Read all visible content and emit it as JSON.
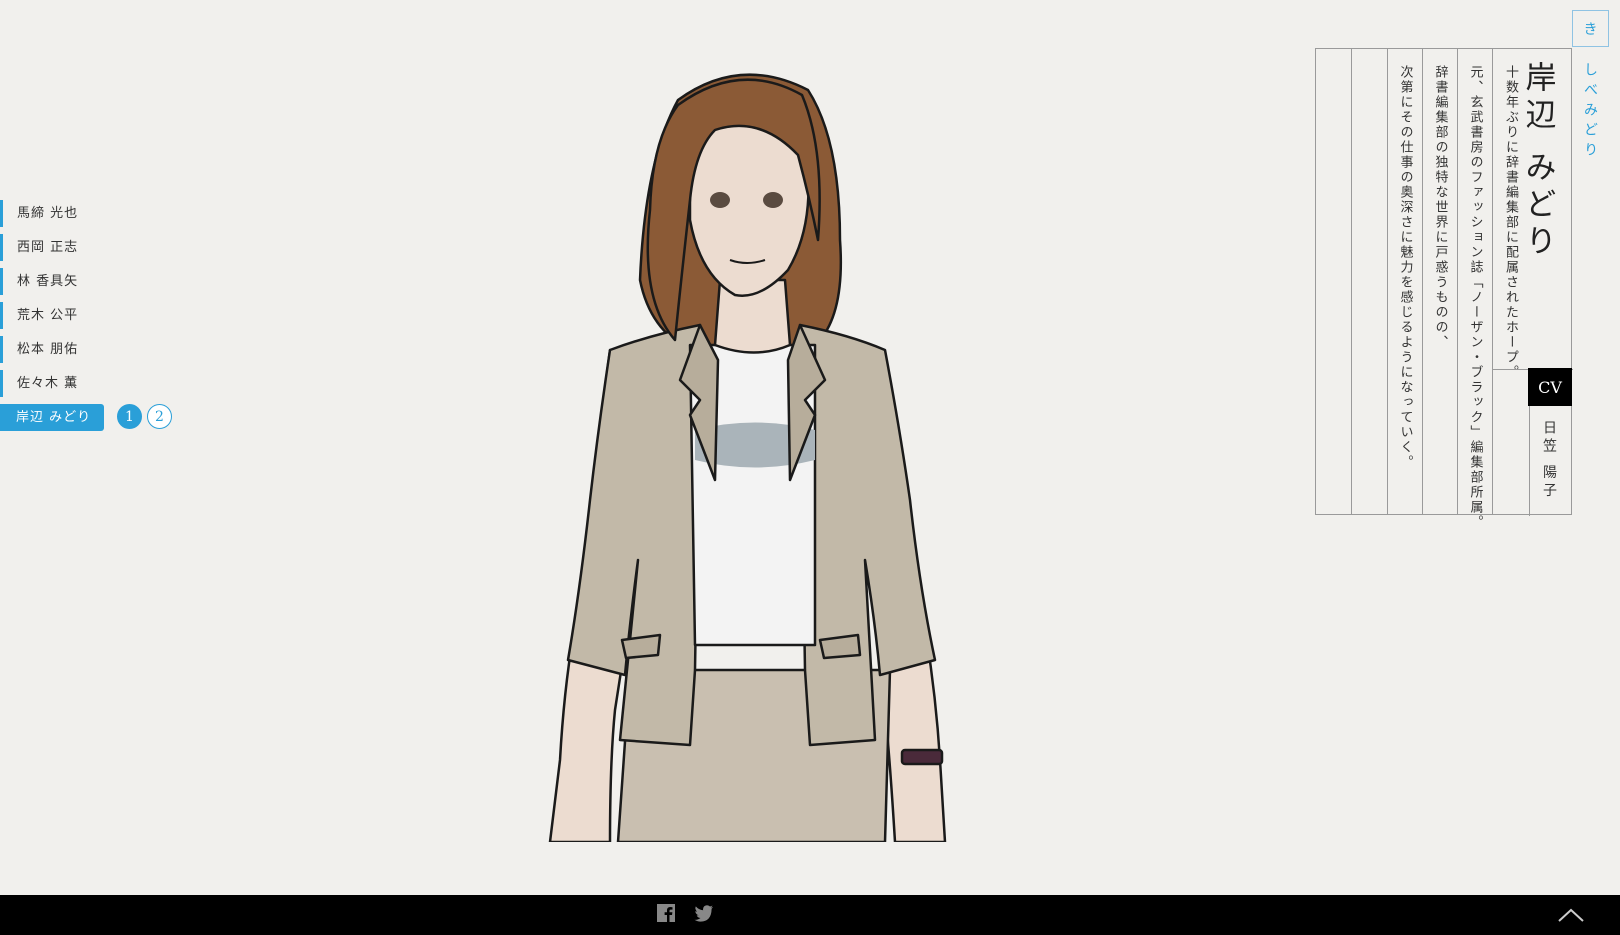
{
  "nav": {
    "items": [
      {
        "label": "馬締 光也"
      },
      {
        "label": "西岡 正志"
      },
      {
        "label": "林 香具矢"
      },
      {
        "label": "荒木 公平"
      },
      {
        "label": "松本 朋佑"
      },
      {
        "label": "佐々木 薫"
      },
      {
        "label": "岸辺 みどり"
      }
    ],
    "pages": [
      "1",
      "2"
    ]
  },
  "profile": {
    "kana_button": "き",
    "ruby": "しべみどり",
    "name": "岸辺 みどり",
    "description": [
      "十数年ぶりに辞書編集部に配属されたホープ。",
      "元、玄武書房のファッション誌「ノーザン・ブラック」編集部所属。",
      "辞書編集部の独特な世界に戸惑うものの、",
      "次第にその仕事の奥深さに魅力を感じるようになっていく。"
    ],
    "cv_label": "CV",
    "cv_name": "日笠 陽子"
  },
  "footer": {
    "icons": [
      "facebook-icon",
      "twitter-icon",
      "chevron-up-icon"
    ]
  },
  "colors": {
    "accent": "#2a9fd8",
    "background": "#f1f0ed",
    "footer": "#000000"
  }
}
